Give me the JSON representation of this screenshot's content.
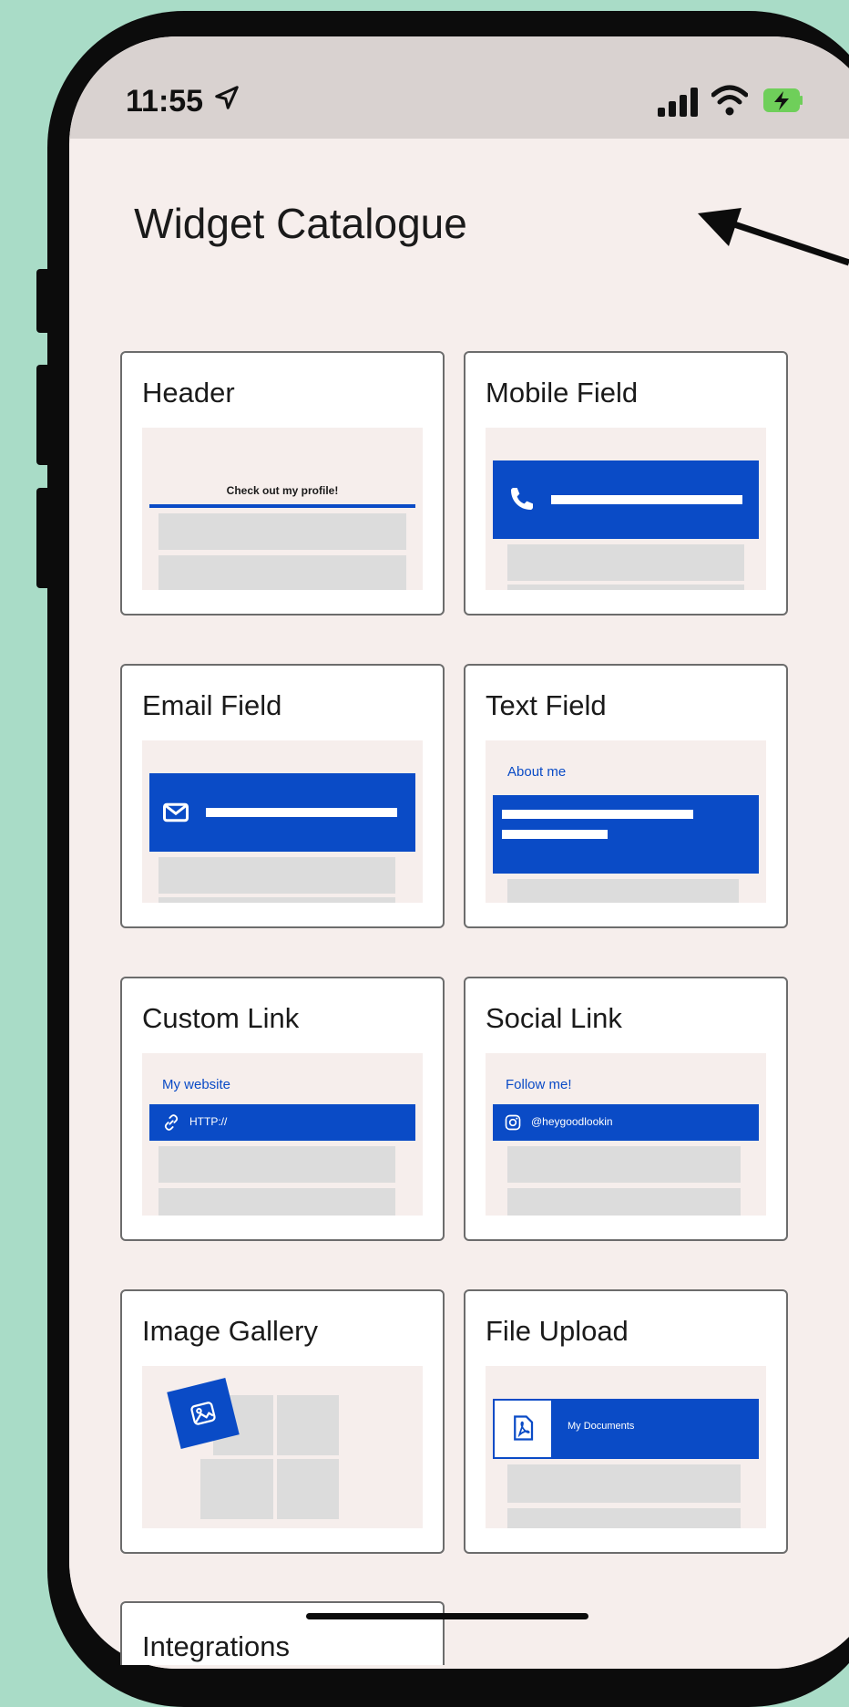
{
  "status": {
    "time": "11:55"
  },
  "page": {
    "title": "Widget Catalogue"
  },
  "widgets": {
    "header": {
      "title": "Header",
      "preview_text": "Check out my profile!"
    },
    "mobile": {
      "title": "Mobile Field"
    },
    "email": {
      "title": "Email Field"
    },
    "text": {
      "title": "Text Field",
      "preview_label": "About me"
    },
    "custom_link": {
      "title": "Custom Link",
      "preview_label": "My website",
      "preview_value": "HTTP://"
    },
    "social_link": {
      "title": "Social Link",
      "preview_label": "Follow me!",
      "preview_value": "@heygoodlookin"
    },
    "image_gallery": {
      "title": "Image Gallery"
    },
    "file_upload": {
      "title": "File Upload",
      "preview_value": "My Documents"
    },
    "integrations": {
      "title": "Integrations"
    }
  },
  "colors": {
    "background": "#a9dcc7",
    "accent": "#0a4bc6",
    "sheet": "#f6eeec"
  },
  "icons": [
    "location-arrow-icon",
    "signal-icon",
    "wifi-icon",
    "battery-charging-icon",
    "phone-icon",
    "mail-icon",
    "link-icon",
    "instagram-icon",
    "image-icon",
    "pdf-file-icon",
    "annotation-arrow-icon"
  ]
}
